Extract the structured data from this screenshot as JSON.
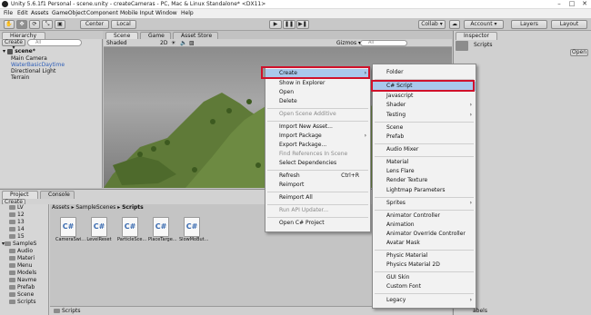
{
  "window": {
    "title": "Unity 5.6.1f1 Personal - scene.unity - createCameras - PC, Mac & Linux Standalone* <DX11>"
  },
  "menubar": [
    "File",
    "Edit",
    "Assets",
    "GameObject",
    "Component",
    "Mobile Input",
    "Window",
    "Help"
  ],
  "toolbar": {
    "center": "Center",
    "local": "Local",
    "collab": "Collab ▾",
    "account": "Account ▾",
    "layers": "Layers",
    "layout": "Layout"
  },
  "hierarchy": {
    "tab": "Hierarchy",
    "create": "Create ▾",
    "search_placeholder": "All",
    "scene_name": "scene*",
    "items": [
      "Main Camera",
      "WaterBasicDaytime",
      "Directional Light",
      "Terrain"
    ]
  },
  "scene": {
    "tabs": [
      "Scene",
      "Game",
      "Asset Store"
    ],
    "shading": "Shaded",
    "mode2d": "2D",
    "gizmos": "Gizmos ▾",
    "search_placeholder": "All"
  },
  "inspector": {
    "tab": "Inspector",
    "title": "Scripts",
    "open": "Open"
  },
  "project": {
    "tabs": [
      "Project",
      "Console"
    ],
    "create": "Create ▾",
    "breadcrumb": [
      "Assets",
      "SampleScenes",
      "Scripts"
    ],
    "tree": [
      "LV",
      "12",
      "13",
      "14",
      "15",
      "SampleS",
      "Audio",
      "Materi",
      "Menu",
      "Models",
      "Navme",
      "Prefab",
      "Scene",
      "Scripts"
    ],
    "assets": [
      "CameraSwi...",
      "LevelReset",
      "ParticleSce...",
      "PlaceTarge...",
      "SlowMoBut..."
    ],
    "asset_glyph": "C#",
    "footer_path": "Scripts",
    "assetbundle_label": "abels"
  },
  "context_menu": {
    "items": [
      {
        "label": "Create",
        "arrow": "›"
      },
      {
        "label": "Show in Explorer"
      },
      {
        "label": "Open"
      },
      {
        "label": "Delete"
      },
      {
        "label": "Open Scene Additive",
        "disabled": true
      },
      {
        "label": "Import New Asset..."
      },
      {
        "label": "Import Package",
        "arrow": "›"
      },
      {
        "label": "Export Package..."
      },
      {
        "label": "Find References In Scene",
        "disabled": true
      },
      {
        "label": "Select Dependencies"
      },
      {
        "label": "Refresh",
        "shortcut": "Ctrl+R"
      },
      {
        "label": "Reimport"
      },
      {
        "label": "Reimport All"
      },
      {
        "label": "Run API Updater...",
        "disabled": true
      },
      {
        "label": "Open C# Project"
      }
    ]
  },
  "create_submenu": {
    "items": [
      {
        "label": "Folder"
      },
      {
        "label": "C# Script"
      },
      {
        "label": "Javascript"
      },
      {
        "label": "Shader",
        "arrow": "›"
      },
      {
        "label": "Testing",
        "arrow": "›"
      },
      {
        "label": "Scene"
      },
      {
        "label": "Prefab"
      },
      {
        "label": "Audio Mixer"
      },
      {
        "label": "Material"
      },
      {
        "label": "Lens Flare"
      },
      {
        "label": "Render Texture"
      },
      {
        "label": "Lightmap Parameters"
      },
      {
        "label": "Sprites",
        "arrow": "›"
      },
      {
        "label": "Animator Controller"
      },
      {
        "label": "Animation"
      },
      {
        "label": "Animator Override Controller"
      },
      {
        "label": "Avatar Mask"
      },
      {
        "label": "Physic Material"
      },
      {
        "label": "Physics Material 2D"
      },
      {
        "label": "GUI Skin"
      },
      {
        "label": "Custom Font"
      },
      {
        "label": "Legacy",
        "arrow": "›"
      }
    ]
  },
  "colors": {
    "highlight_border": "#d0112b",
    "selected_item": "#a9c8ec"
  }
}
